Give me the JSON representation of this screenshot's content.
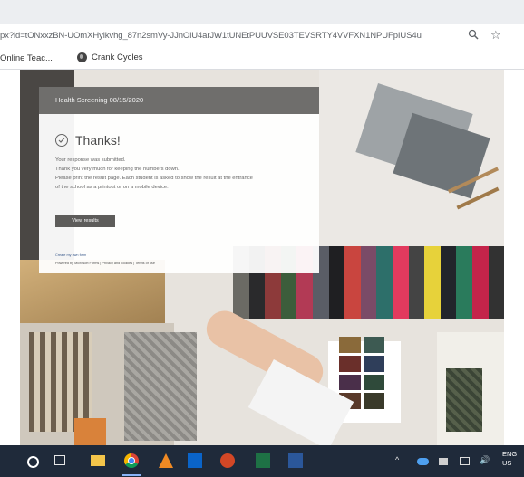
{
  "browser": {
    "url": "px?id=tONxxzBN-UOmXHyikvhg_87n2smVy-JJnOlU4arJW1tUNEtPUUVSE03TEVSRTY4VVFXN1NPUFpIUS4u",
    "zoom_icon": "zoom-icon",
    "star_icon": "star-icon",
    "bookmarks": [
      {
        "label": "Online Teac...",
        "icon": ""
      },
      {
        "label": "Crank Cycles",
        "icon": "globe-icon"
      }
    ]
  },
  "form": {
    "header_title": "Health Screening 08/15/2020",
    "thanks_title": "Thanks!",
    "lines": [
      "Your response was submitted.",
      "Thank you very much for keeping the numbers down.",
      "Please print the result page. Each student is asked to show the result at the entrance",
      "of the school as a printout or on a mobile device."
    ],
    "view_results_label": "View results",
    "create_form_link": "Create my own form",
    "footer_text": "Powered by Microsoft Forms | Privacy and cookies | Terms of use"
  },
  "taskbar": {
    "apps": [
      "search-icon",
      "task-view-icon",
      "file-explorer-icon",
      "chrome-icon",
      "vlc-icon",
      "outlook-icon",
      "powerpoint-icon",
      "excel-icon",
      "word-icon"
    ],
    "tray_up": "^",
    "volume": "🔊",
    "language_top": "ENG",
    "language_bottom": "US"
  }
}
